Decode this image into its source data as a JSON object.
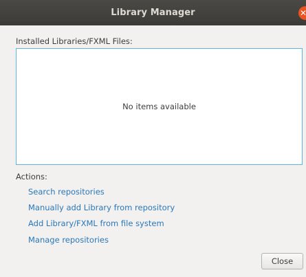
{
  "window": {
    "title": "Library Manager",
    "close_glyph": "✕"
  },
  "installed": {
    "label": "Installed Libraries/FXML Files:",
    "empty_text": "No items available"
  },
  "actions": {
    "label": "Actions:",
    "items": [
      {
        "label": "Search repositories"
      },
      {
        "label": "Manually add Library from repository"
      },
      {
        "label": "Add Library/FXML from file system"
      },
      {
        "label": "Manage repositories"
      }
    ]
  },
  "footer": {
    "close_label": "Close"
  },
  "colors": {
    "titlebar": "#3c3b37",
    "close_dot": "#e95420",
    "link": "#2a77b8",
    "focus_border": "#5bb5de",
    "background": "#f2f1f0"
  }
}
